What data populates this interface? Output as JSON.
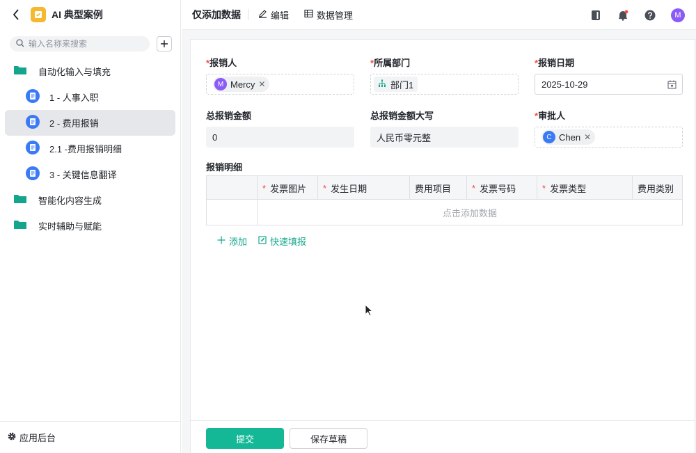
{
  "app": {
    "title": "AI 典型案例"
  },
  "sidebar": {
    "search_placeholder": "输入名称来搜索",
    "items": [
      {
        "type": "folder",
        "label": "自动化输入与填充"
      },
      {
        "type": "page",
        "label": "1 - 人事入职"
      },
      {
        "type": "page",
        "label": "2 - 费用报销",
        "active": true
      },
      {
        "type": "page",
        "label": "2.1 -费用报销明细"
      },
      {
        "type": "page",
        "label": "3 - 关键信息翻译"
      },
      {
        "type": "folder",
        "label": "智能化内容生成"
      },
      {
        "type": "folder",
        "label": "实时辅助与赋能"
      }
    ],
    "footer_label": "应用后台"
  },
  "topbar": {
    "title": "仅添加数据",
    "edit_label": "编辑",
    "data_manage_label": "数据管理",
    "user_initial": "M"
  },
  "form": {
    "reimburser": {
      "label": "报销人",
      "required": true,
      "value": "Mercy",
      "initial": "M"
    },
    "department": {
      "label": "所属部门",
      "required": true,
      "value": "部门1"
    },
    "date": {
      "label": "报销日期",
      "required": true,
      "value": "2025-10-29"
    },
    "total_amount": {
      "label": "总报销金额",
      "value": "0"
    },
    "total_amount_upper": {
      "label": "总报销金额大写",
      "value": "人民币零元整"
    },
    "approver": {
      "label": "审批人",
      "required": true,
      "value": "Chen",
      "initial": "C"
    }
  },
  "detail_table": {
    "label": "报销明细",
    "columns": [
      {
        "label": "发票图片",
        "required": true
      },
      {
        "label": "发生日期",
        "required": true
      },
      {
        "label": "费用项目",
        "required": false
      },
      {
        "label": "发票号码",
        "required": true
      },
      {
        "label": "发票类型",
        "required": true
      },
      {
        "label": "费用类别",
        "required": false
      }
    ],
    "empty_text": "点击添加数据",
    "add_label": "添加",
    "quick_fill_label": "快速填报"
  },
  "footer": {
    "submit_label": "提交",
    "draft_label": "保存草稿"
  },
  "colors": {
    "accent": "#14b897",
    "required": "#f54a45",
    "avatar_mercy": "#8a5cf5",
    "avatar_chen": "#3a7af5"
  }
}
